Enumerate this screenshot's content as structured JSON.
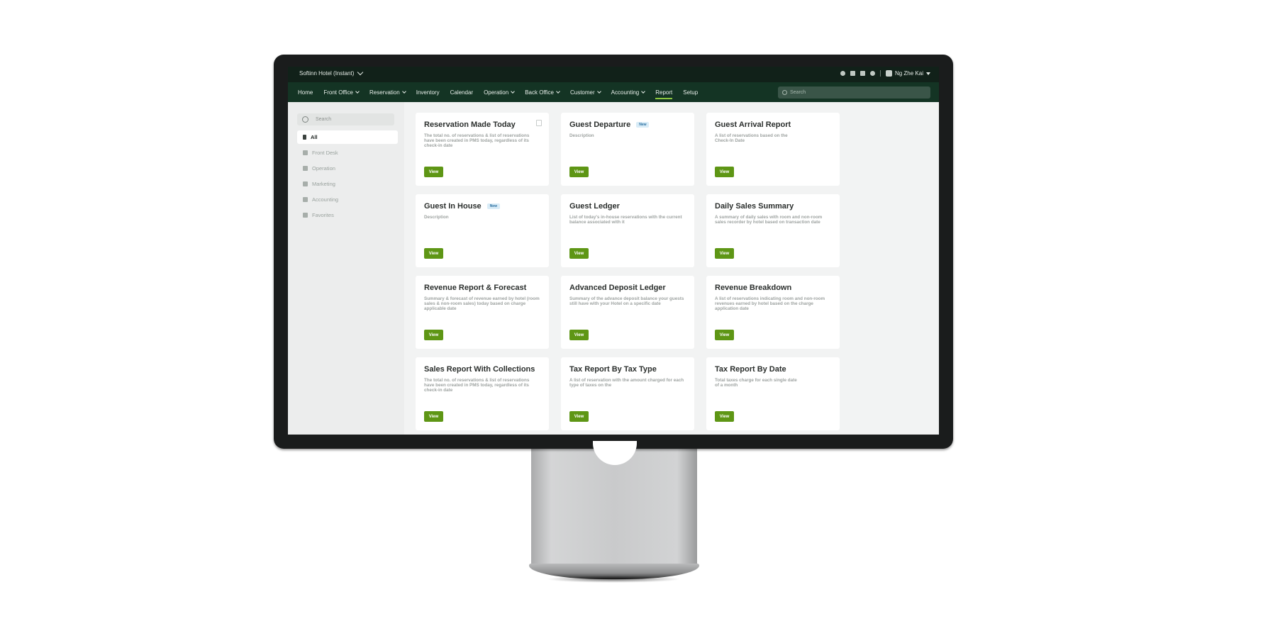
{
  "topbar": {
    "hotel_name": "Softinn Hotel (Instant)",
    "user_name": "Ng Zhe Kai"
  },
  "nav": {
    "items": [
      {
        "label": "Home",
        "dropdown": false
      },
      {
        "label": "Front Office",
        "dropdown": true
      },
      {
        "label": "Reservation",
        "dropdown": true
      },
      {
        "label": "Inventory",
        "dropdown": false
      },
      {
        "label": "Calendar",
        "dropdown": false
      },
      {
        "label": "Operation",
        "dropdown": true
      },
      {
        "label": "Back Office",
        "dropdown": true
      },
      {
        "label": "Customer",
        "dropdown": true
      },
      {
        "label": "Accounting",
        "dropdown": true
      },
      {
        "label": "Report",
        "dropdown": false,
        "active": true
      },
      {
        "label": "Setup",
        "dropdown": false
      }
    ],
    "search_placeholder": "Search"
  },
  "sidebar": {
    "search_placeholder": "Search",
    "items": [
      {
        "label": "All",
        "icon": "sort-icon",
        "active": true
      },
      {
        "label": "Front Desk",
        "icon": "monitor-icon"
      },
      {
        "label": "Operation",
        "icon": "gear-icon"
      },
      {
        "label": "Marketing",
        "icon": "trend-icon"
      },
      {
        "label": "Accounting",
        "icon": "ledger-icon"
      },
      {
        "label": "Favorites",
        "icon": "star-icon"
      }
    ]
  },
  "cards": [
    {
      "title": "Reservation Made Today",
      "badge": "",
      "description": "The total no. of reservations & list of reservations have been created in PMS today, regardless of its check-in date",
      "button": "View"
    },
    {
      "title": "Guest Departure",
      "badge": "New",
      "description": "Description",
      "button": "View"
    },
    {
      "title": "Guest Arrival Report",
      "badge": "",
      "description": "A list of reservations based on the Check-In Date",
      "button": "View"
    },
    {
      "title": "Guest In House",
      "badge": "New",
      "description": "Description",
      "button": "View"
    },
    {
      "title": "Guest Ledger",
      "badge": "",
      "description": "List of today's in-house reservations with the current balance associated with it",
      "button": "View"
    },
    {
      "title": "Daily Sales Summary",
      "badge": "",
      "description": "A summary of daily sales with room and non-room sales recorder by hotel based on transaction date",
      "button": "View"
    },
    {
      "title": "Revenue Report & Forecast",
      "badge": "",
      "description": "Summary & forecast of revenue earned by hotel (room sales & non-room sales) today based on charge applicable date",
      "button": "View"
    },
    {
      "title": "Advanced Deposit Ledger",
      "badge": "",
      "description": "Summary of the advance deposit balance your guests still have with your Hotel on a specific date",
      "button": "View"
    },
    {
      "title": "Revenue Breakdown",
      "badge": "",
      "description": "A list of reservations indicating room and non-room revenues earned by hotel based on the charge application date",
      "button": "View"
    },
    {
      "title": "Sales Report With Collections",
      "badge": "",
      "description": "The total no. of reservations & list of reservations have been created in PMS today, regardless of its check-in date",
      "button": "View"
    },
    {
      "title": "Tax Report By Tax Type",
      "badge": "",
      "description": "A list of reservation with the amount charged for each type of taxes on the",
      "button": "View"
    },
    {
      "title": "Tax Report By Date",
      "badge": "",
      "description": "Total taxes charge for each single date of a month",
      "button": "View"
    }
  ],
  "colors": {
    "topbar_bg": "#112119",
    "navbar_bg": "#143424",
    "view_button": "#5e9615",
    "active_underline": "#8cc63f"
  }
}
